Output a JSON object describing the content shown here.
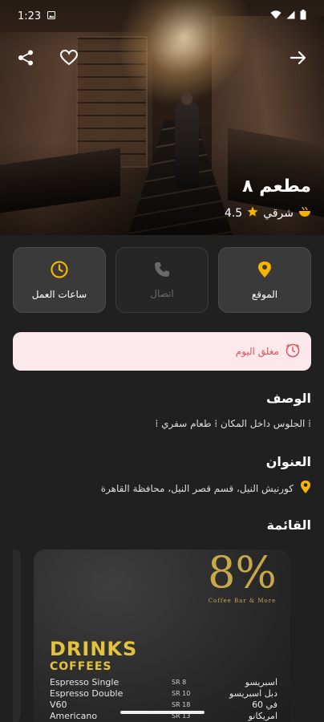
{
  "status_bar": {
    "time": "1:23"
  },
  "hero": {
    "title": "مطعم ٨",
    "cuisine": "شرقي",
    "rating": "4.5"
  },
  "actions": [
    {
      "label": "الموقع",
      "icon": "location-pin-icon",
      "state": "enabled"
    },
    {
      "label": "اتصال",
      "icon": "phone-icon",
      "state": "disabled"
    },
    {
      "label": "ساعات العمل",
      "icon": "clock-icon",
      "state": "enabled"
    }
  ],
  "status_notice": {
    "text": "مغلق اليوم",
    "color": "#e05560",
    "background": "#fde8ec"
  },
  "description": {
    "title": "الوصف",
    "text": "⁞ الجلوس داخل المكان ⁞ طعام سفري ⁞"
  },
  "address": {
    "title": "العنوان",
    "text": "كورنيش النيل، قسم قصر النيل، محافظة القاهرة"
  },
  "menu": {
    "title": "القائمة",
    "card": {
      "brand_big": "8%",
      "brand_tag": "Coffee Bar & More",
      "heading": "DRINKS",
      "subheading": "COFFEES",
      "items": [
        {
          "en": "Espresso Single",
          "price": "SR 8",
          "ar": "اسبريسو"
        },
        {
          "en": "Espresso Double",
          "price": "SR 10",
          "ar": "دبل اسبريسو"
        },
        {
          "en": "V60",
          "price": "SR 18",
          "ar": "في 60"
        },
        {
          "en": "Americano",
          "price": "SR 13",
          "ar": "امريكانو"
        }
      ]
    }
  },
  "colors": {
    "background": "#202020",
    "accent_yellow": "#f5b500",
    "menu_gold": "#c9a84c"
  }
}
